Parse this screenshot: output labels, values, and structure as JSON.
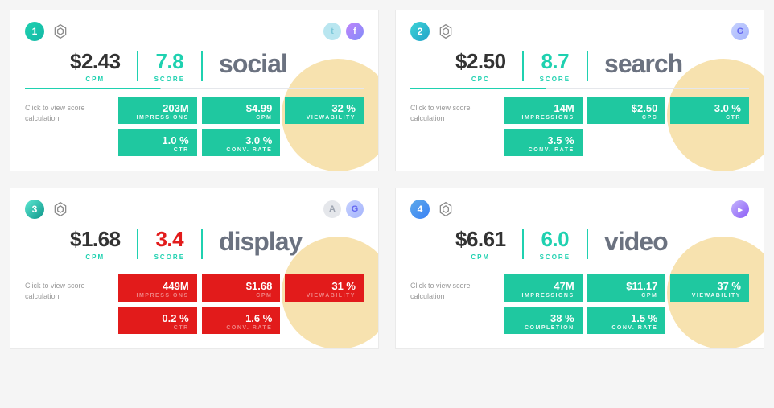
{
  "cards": [
    {
      "num": "1",
      "badgeClass": "b1",
      "platforms": [
        {
          "name": "twitter-icon",
          "cls": "pi-twitter",
          "glyph": "t"
        },
        {
          "name": "facebook-icon",
          "cls": "pi-facebook",
          "glyph": "f"
        }
      ],
      "cost": {
        "value": "$2.43",
        "label": "CPM"
      },
      "score": {
        "value": "7.8",
        "label": "SCORE",
        "cls": "score-good"
      },
      "category": "social",
      "calcText": "Click to view score calculation",
      "metricCls": "metric-good",
      "metrics": [
        {
          "value": "203M",
          "label": "IMPRESSIONS"
        },
        {
          "value": "$4.99",
          "label": "CPM"
        },
        {
          "value": "32 %",
          "label": "VIEWABILITY"
        },
        {
          "value": "1.0 %",
          "label": "CTR"
        },
        {
          "value": "3.0 %",
          "label": "CONV. RATE"
        },
        null
      ]
    },
    {
      "num": "2",
      "badgeClass": "b2",
      "platforms": [
        {
          "name": "google-icon",
          "cls": "pi-google",
          "glyph": "G"
        }
      ],
      "cost": {
        "value": "$2.50",
        "label": "CPC"
      },
      "score": {
        "value": "8.7",
        "label": "SCORE",
        "cls": "score-good"
      },
      "category": "search",
      "calcText": "Click to view score calculation",
      "metricCls": "metric-good",
      "metrics": [
        {
          "value": "14M",
          "label": "IMPRESSIONS"
        },
        {
          "value": "$2.50",
          "label": "CPC"
        },
        {
          "value": "3.0 %",
          "label": "CTR"
        },
        {
          "value": "3.5 %",
          "label": "CONV. RATE"
        },
        null,
        null
      ]
    },
    {
      "num": "3",
      "badgeClass": "b3",
      "platforms": [
        {
          "name": "adobe-icon",
          "cls": "pi-adobe",
          "glyph": "A"
        },
        {
          "name": "google-icon",
          "cls": "pi-google",
          "glyph": "G"
        }
      ],
      "cost": {
        "value": "$1.68",
        "label": "CPM"
      },
      "score": {
        "value": "3.4",
        "label": "SCORE",
        "cls": "score-bad"
      },
      "category": "display",
      "calcText": "Click to view score calculation",
      "metricCls": "metric-bad",
      "metrics": [
        {
          "value": "449M",
          "label": "IMPRESSIONS"
        },
        {
          "value": "$1.68",
          "label": "CPM"
        },
        {
          "value": "31 %",
          "label": "VIEWABILITY"
        },
        {
          "value": "0.2 %",
          "label": "CTR"
        },
        {
          "value": "1.6 %",
          "label": "CONV. RATE"
        },
        null
      ]
    },
    {
      "num": "4",
      "badgeClass": "b4",
      "platforms": [
        {
          "name": "video-platform-icon",
          "cls": "pi-video",
          "glyph": "▸"
        }
      ],
      "cost": {
        "value": "$6.61",
        "label": "CPM"
      },
      "score": {
        "value": "6.0",
        "label": "SCORE",
        "cls": "score-mid"
      },
      "category": "video",
      "calcText": "Click to view score calculation",
      "metricCls": "metric-good",
      "metrics": [
        {
          "value": "47M",
          "label": "IMPRESSIONS"
        },
        {
          "value": "$11.17",
          "label": "CPM"
        },
        {
          "value": "37 %",
          "label": "VIEWABILITY"
        },
        {
          "value": "38 %",
          "label": "COMPLETION"
        },
        {
          "value": "1.5 %",
          "label": "CONV. RATE"
        },
        null
      ]
    }
  ]
}
